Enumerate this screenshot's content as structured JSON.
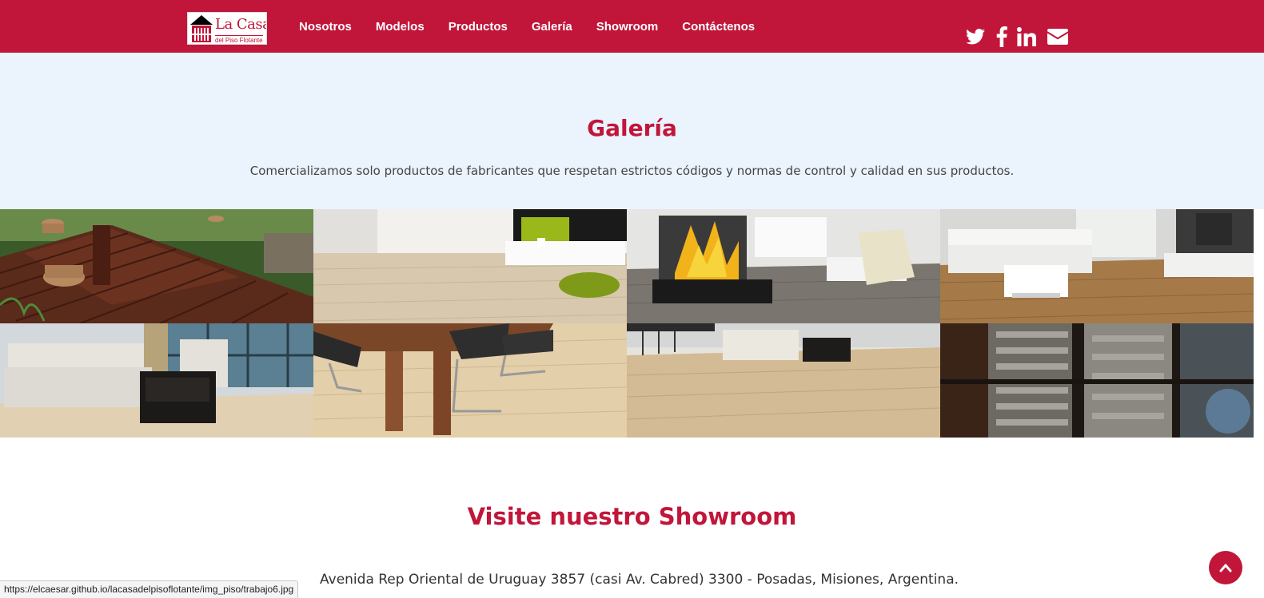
{
  "brand": {
    "logo_main": "La Casa",
    "logo_sub": "del Piso Flotante",
    "primary_color": "#c1163a",
    "light_bg": "#ebf3fd"
  },
  "nav": {
    "items": [
      {
        "label": "Nosotros"
      },
      {
        "label": "Modelos"
      },
      {
        "label": "Productos"
      },
      {
        "label": "Galería"
      },
      {
        "label": "Showroom"
      },
      {
        "label": "Contáctenos"
      }
    ],
    "social": [
      "twitter-icon",
      "facebook-icon",
      "linkedin-icon",
      "envelope-icon"
    ]
  },
  "gallery": {
    "title": "Galería",
    "description": "Comercializamos solo productos de fabricantes que respetan estrictos códigos y normas de control y calidad en sus productos.",
    "images": [
      "deck-garden-image",
      "living-room-light-floor-image",
      "fireplace-living-room-image",
      "sectional-sofa-room-image",
      "white-sofa-room-image",
      "dining-table-chairs-image",
      "sofa-office-floor-image",
      "lumber-stack-image"
    ]
  },
  "showroom": {
    "title": "Visite nuestro Showroom",
    "address": "Avenida Rep Oriental de Uruguay 3857 (casi Av. Cabred) 3300 - Posadas, Misiones, Argentina."
  },
  "status_bar": {
    "url": "https://elcaesar.github.io/lacasadelpisoflotante/img_piso/trabajo6.jpg"
  },
  "back_to_top": "chevron-up-icon"
}
